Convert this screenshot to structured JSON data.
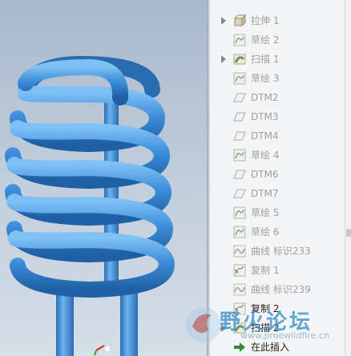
{
  "model_tree": {
    "items": [
      {
        "label": "拉伸 1",
        "icon": "extrude-icon",
        "expandable": true,
        "active": false
      },
      {
        "label": "草绘 2",
        "icon": "sketch-icon",
        "expandable": false,
        "active": false
      },
      {
        "label": "扫描 1",
        "icon": "sweep-icon",
        "expandable": true,
        "active": false
      },
      {
        "label": "草绘 3",
        "icon": "sketch-icon",
        "expandable": false,
        "active": false
      },
      {
        "label": "DTM2",
        "icon": "datum-plane-icon",
        "expandable": false,
        "active": false
      },
      {
        "label": "DTM3",
        "icon": "datum-plane-icon",
        "expandable": false,
        "active": false
      },
      {
        "label": "DTM4",
        "icon": "datum-plane-icon",
        "expandable": false,
        "active": false
      },
      {
        "label": "草绘 4",
        "icon": "sketch-icon",
        "expandable": false,
        "active": false
      },
      {
        "label": "DTM6",
        "icon": "datum-plane-icon",
        "expandable": false,
        "active": false
      },
      {
        "label": "DTM7",
        "icon": "datum-plane-icon",
        "expandable": false,
        "active": false
      },
      {
        "label": "草绘 5",
        "icon": "sketch-icon",
        "expandable": false,
        "active": false
      },
      {
        "label": "草绘 6",
        "icon": "sketch-icon",
        "expandable": false,
        "active": false
      },
      {
        "label": "曲线 标识233",
        "icon": "curve-icon",
        "expandable": false,
        "active": false
      },
      {
        "label": "复制 1",
        "icon": "copy-icon",
        "expandable": false,
        "active": false
      },
      {
        "label": "曲线 标识239",
        "icon": "curve-icon",
        "expandable": false,
        "active": false
      },
      {
        "label": "复制 2",
        "icon": "copy-icon",
        "expandable": false,
        "active": true
      },
      {
        "label": "扫描 2",
        "icon": "sweep-icon",
        "expandable": true,
        "active": true
      },
      {
        "label": "在此插入",
        "icon": "insert-here-icon",
        "expandable": false,
        "active": true
      }
    ]
  },
  "watermark": {
    "site_name": "野火论坛",
    "url": "www.proewildfire.cn"
  },
  "colors": {
    "spring": "#3d8fdc",
    "background_top": "#a9b9cc",
    "insert_arrow": "#2e8b2e"
  }
}
